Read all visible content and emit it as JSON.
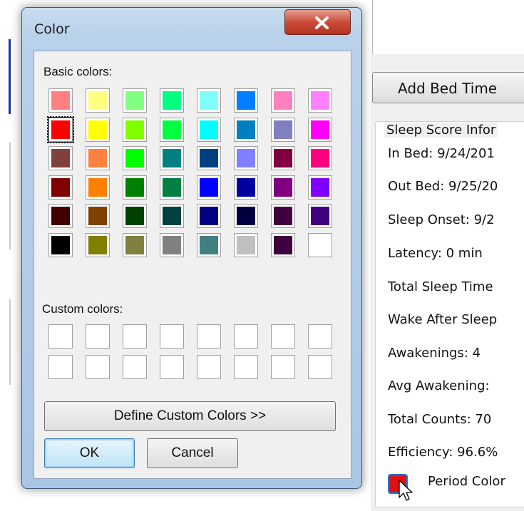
{
  "dialog": {
    "title": "Color",
    "basic_colors_label": "Basic colors:",
    "custom_colors_label": "Custom colors:",
    "basic_colors": [
      [
        "#ff8080",
        "#ffff80",
        "#80ff80",
        "#00ff80",
        "#80ffff",
        "#0080ff",
        "#ff80c0",
        "#ff80ff"
      ],
      [
        "#ff0000",
        "#ffff00",
        "#80ff00",
        "#00ff40",
        "#00ffff",
        "#0080c0",
        "#8080c0",
        "#ff00ff"
      ],
      [
        "#804040",
        "#ff8040",
        "#00ff00",
        "#008080",
        "#004080",
        "#8080ff",
        "#800040",
        "#ff0080"
      ],
      [
        "#800000",
        "#ff8000",
        "#008000",
        "#008040",
        "#0000ff",
        "#0000a0",
        "#800080",
        "#8000ff"
      ],
      [
        "#400000",
        "#804000",
        "#004000",
        "#004040",
        "#000080",
        "#000040",
        "#400040",
        "#400080"
      ],
      [
        "#000000",
        "#808000",
        "#808040",
        "#808080",
        "#408080",
        "#c0c0c0",
        "#400040",
        "#ffffff"
      ]
    ],
    "selected_color": "#ff0000",
    "custom_colors": [
      [
        "#ffffff",
        "#ffffff",
        "#ffffff",
        "#ffffff",
        "#ffffff",
        "#ffffff",
        "#ffffff",
        "#ffffff"
      ],
      [
        "#ffffff",
        "#ffffff",
        "#ffffff",
        "#ffffff",
        "#ffffff",
        "#ffffff",
        "#ffffff",
        "#ffffff"
      ]
    ],
    "define_custom_label": "Define Custom Colors >>",
    "ok_label": "OK",
    "cancel_label": "Cancel",
    "close_icon": "close-icon"
  },
  "app": {
    "add_bed_time_label": "Add Bed Time",
    "sleep_score_title": "Sleep Score Infor",
    "info_lines": [
      "In Bed: 9/24/201",
      "Out Bed: 9/25/20",
      "Sleep Onset: 9/2",
      "Latency: 0 min",
      "Total Sleep Time",
      "Wake After Sleep",
      "Awakenings: 4",
      "Avg Awakening:",
      "Total Counts: 70",
      "Efficiency: 96.6%"
    ],
    "period_color_label": "Period Color",
    "period_color": "#e01010"
  }
}
